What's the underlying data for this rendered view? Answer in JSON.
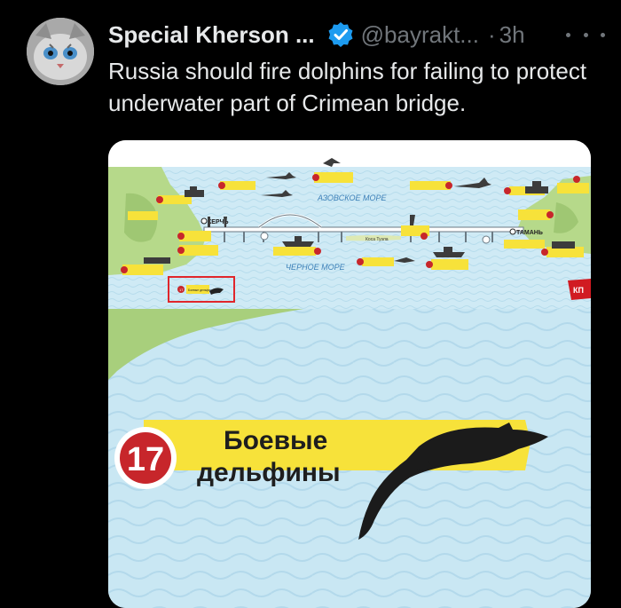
{
  "tweet": {
    "display_name": "Special Kherson ...",
    "handle": "@bayrakt...",
    "separator": "·",
    "time": "3h",
    "text": "Russia should fire dolphins for failing to protect underwater part of Crimean bridge."
  },
  "map": {
    "azov_sea": "АЗОВСКОЕ МОРЕ",
    "black_sea": "ЧЕРНОЕ МОРЕ",
    "kerch": "КЕРЧЬ",
    "taman": "ТАМАНЬ",
    "tuzla": "Коса Тузла",
    "logo": "КП",
    "marker_17": "17",
    "small_dolphins": "Боевые дельфины"
  },
  "zoom": {
    "number": "17",
    "line1": "Боевые",
    "line2": "дельфины"
  },
  "colors": {
    "background": "#000000",
    "text": "#e7e9ea",
    "secondary": "#71767b",
    "verified": "#1d9bf0",
    "sea": "#c9e7f3",
    "land": "#a8cf7c",
    "label_yellow": "#f7e23a",
    "badge_red": "#c7262b"
  }
}
